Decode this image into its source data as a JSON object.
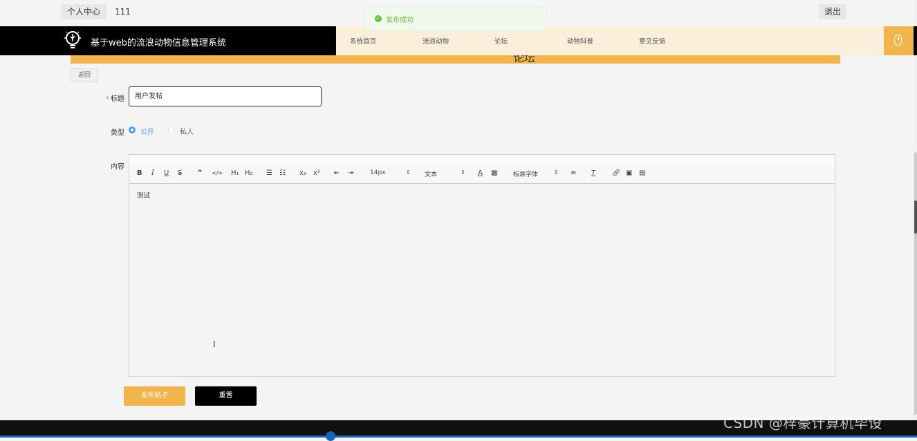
{
  "topbar": {
    "user_center": "个人中心",
    "username": "111",
    "logout": "退出"
  },
  "toast": {
    "message": "发布成功",
    "icon": "check-circle-icon",
    "color": "#67c23a"
  },
  "header": {
    "site_title": "基于web的流浪动物信息管理系统",
    "nav": [
      "系统首页",
      "流浪动物",
      "论坛",
      "动物科普",
      "意见反馈"
    ],
    "accent": "#f2b44c"
  },
  "banner": {
    "title": "论坛"
  },
  "form": {
    "back": "返回",
    "title_label": "标题",
    "title_value": "用户发帖",
    "type_label": "类型",
    "type_options": [
      "公开",
      "私人"
    ],
    "type_selected": "公开",
    "content_label": "内容",
    "editor": {
      "font_size": "14px",
      "header_select": "文本",
      "font_family": "标准字体",
      "content": "测试"
    },
    "publish": "发布帖子",
    "reset": "重置"
  },
  "watermark": "CSDN @梓豪计算机毕设"
}
